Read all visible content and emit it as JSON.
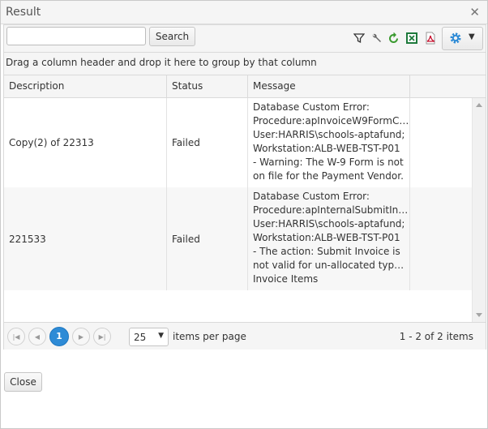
{
  "window": {
    "title": "Result"
  },
  "toolbar": {
    "search_value": "",
    "search_button": "Search",
    "icons": [
      "filter-icon",
      "wrench-icon",
      "refresh-icon",
      "excel-icon",
      "pdf-icon",
      "gear-icon",
      "chevron-down-icon"
    ]
  },
  "group_panel": {
    "text": "Drag a column header and drop it here to group by that column"
  },
  "columns": [
    "Description",
    "Status",
    "Message",
    ""
  ],
  "rows": [
    {
      "description": "Copy(2) of 22313",
      "status": "Failed",
      "message_lines": [
        "Database Custom Error:",
        "Procedure:apInvoiceW9FormC…",
        "User:HARRIS\\schools-aptafund;",
        "Workstation:ALB-WEB-TST-P01",
        "- Warning: The W-9 Form is not",
        "on file for the Payment Vendor."
      ]
    },
    {
      "description": "221533",
      "status": "Failed",
      "message_lines": [
        "Database Custom Error:",
        "Procedure:apInternalSubmitIn…",
        "User:HARRIS\\schools-aptafund;",
        "Workstation:ALB-WEB-TST-P01",
        "- The action: Submit Invoice is",
        "not valid for un-allocated type of",
        "Invoice Items"
      ]
    }
  ],
  "pager": {
    "current_page": "1",
    "page_size": "25",
    "items_per_page_label": "items per page",
    "info": "1 - 2 of 2 items"
  },
  "footer": {
    "close_label": "Close"
  },
  "colors": {
    "accent": "#2e8bd6",
    "excel_green": "#1e7a3c",
    "pdf_red": "#c8102e",
    "refresh_green": "#3a9a2f"
  }
}
